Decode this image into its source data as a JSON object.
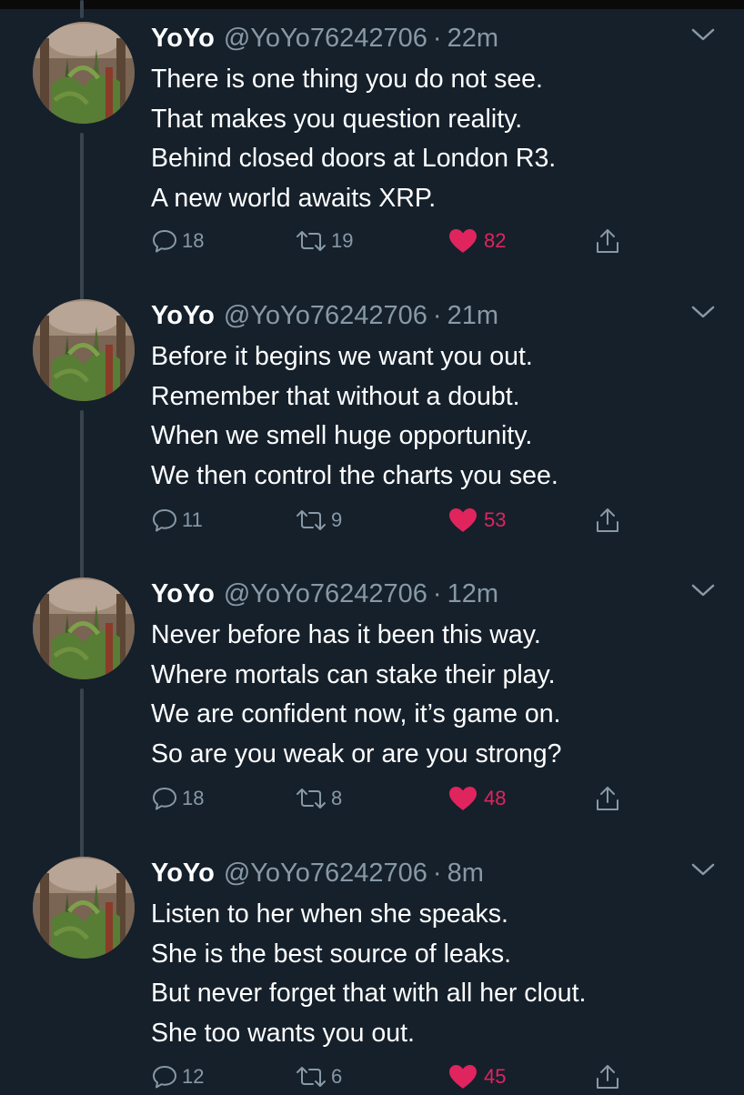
{
  "colors": {
    "background": "#15202b",
    "text": "#ffffff",
    "muted": "#8899a6",
    "like": "#e0245e",
    "thread_line": "#38444d"
  },
  "icons": {
    "reply": "reply-icon",
    "retweet": "retweet-icon",
    "like": "heart-icon",
    "share": "share-icon",
    "menu": "chevron-down-icon"
  },
  "tweets": [
    {
      "name": "YoYo",
      "handle": "@YoYo76242706",
      "separator": "·",
      "time": "22m",
      "lines": [
        "There is one thing you do not see.",
        "That makes you question reality.",
        "Behind closed doors at London R3.",
        "A new world awaits XRP."
      ],
      "replies": "18",
      "retweets": "19",
      "likes": "82",
      "liked": true
    },
    {
      "name": "YoYo",
      "handle": "@YoYo76242706",
      "separator": "·",
      "time": "21m",
      "lines": [
        "Before it begins we want you out.",
        "Remember that without a doubt.",
        "When we smell huge opportunity.",
        "We then control the charts you see."
      ],
      "replies": "11",
      "retweets": "9",
      "likes": "53",
      "liked": true
    },
    {
      "name": "YoYo",
      "handle": "@YoYo76242706",
      "separator": "·",
      "time": "12m",
      "lines": [
        "Never before has it been this way.",
        "Where mortals can stake their play.",
        "We are confident now, it’s game on.",
        "So are you weak or are you strong?"
      ],
      "replies": "18",
      "retweets": "8",
      "likes": "48",
      "liked": true
    },
    {
      "name": "YoYo",
      "handle": "@YoYo76242706",
      "separator": "·",
      "time": "8m",
      "lines": [
        "Listen to her when she speaks.",
        "She is the best source of leaks.",
        "But never forget that with all her clout.",
        "She too wants you out."
      ],
      "replies": "12",
      "retweets": "6",
      "likes": "45",
      "liked": true
    }
  ]
}
